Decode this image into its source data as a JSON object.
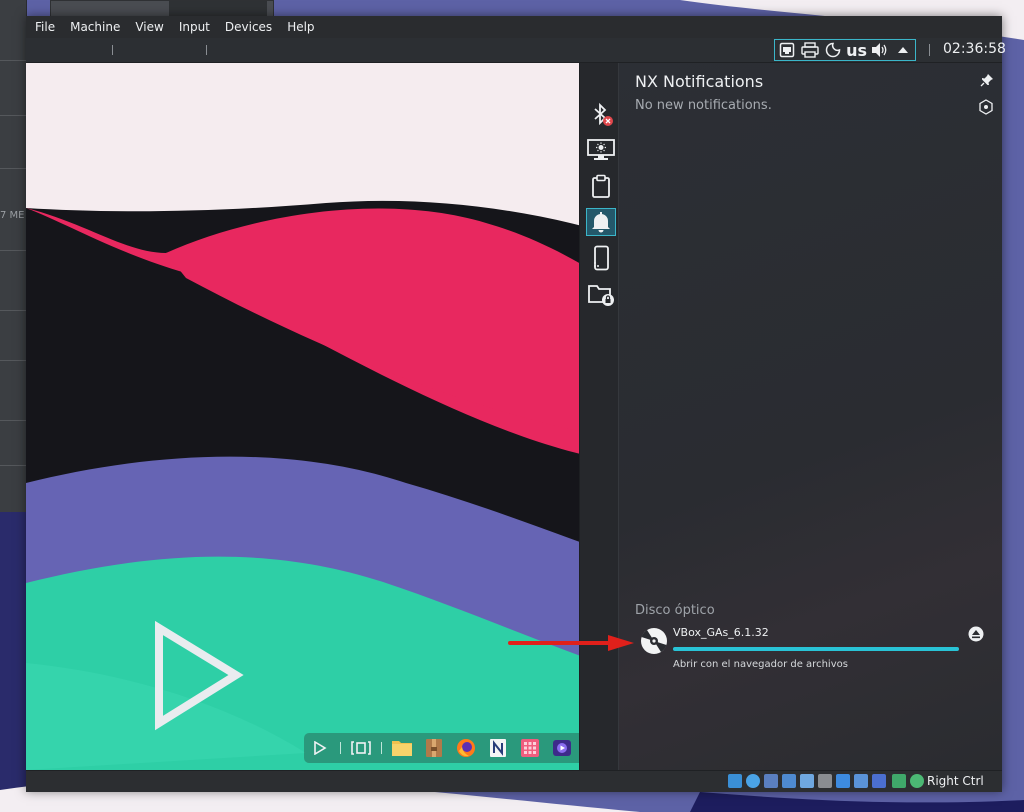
{
  "menu": {
    "items": [
      "File",
      "Machine",
      "View",
      "Input",
      "Devices",
      "Help"
    ]
  },
  "tray": {
    "keyboard_layout": "us",
    "clock": "02:36:58",
    "icons": [
      "network-icon",
      "printer-icon",
      "night-mode-icon",
      "keyboard-layout",
      "volume-icon",
      "tray-expand-icon"
    ]
  },
  "host": {
    "left_window_text": "7 ME"
  },
  "notifications": {
    "title": "NX Notifications",
    "empty_text": "No new notifications.",
    "sidebar": [
      "bluetooth-icon",
      "display-brightness-icon",
      "clipboard-icon",
      "notifications-bell-icon",
      "device-connect-icon",
      "vault-folder-icon"
    ],
    "active_sidebar": "notifications-bell-icon",
    "device_section": "Disco óptico",
    "device": {
      "name": "VBox_GAs_6.1.32",
      "usage_fraction": 1.0,
      "action": "Abrir con el navegador de archivos"
    }
  },
  "dock": {
    "items": [
      "launcher-icon",
      "workspaces-icon",
      "files-icon",
      "archive-icon",
      "firefox-icon",
      "notes-icon",
      "calculator-icon",
      "media-player-icon"
    ]
  },
  "statusbar": {
    "host_key": "Right Ctrl",
    "icons": [
      "hdd-icon",
      "optical-drive-icon",
      "audio-icon",
      "network-adapter-icon",
      "usb-icon",
      "shared-folders-icon",
      "display-icon",
      "video-capture-icon",
      "virtualization-icon",
      "mouse-integration-icon",
      "keyboard-capture-icon"
    ]
  },
  "colors": {
    "accent": "#29c3d6",
    "menubar": "#2a2c2f",
    "arrow": "#e0201b"
  }
}
